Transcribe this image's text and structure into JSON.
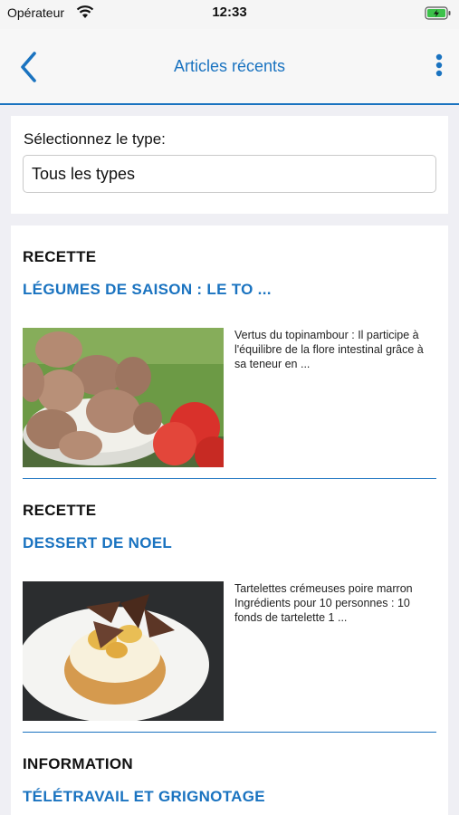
{
  "status_bar": {
    "carrier": "Opérateur",
    "time": "12:33",
    "icons": [
      "wifi-icon",
      "battery-charging-icon"
    ]
  },
  "nav": {
    "title": "Articles récents",
    "back_icon": "chevron-left-icon",
    "menu_icon": "more-vertical-icon"
  },
  "filter": {
    "label": "Sélectionnez le type:",
    "selected": "Tous les types"
  },
  "articles": [
    {
      "type": "RECETTE",
      "title": "LÉGUMES DE SAISON : LE TO ...",
      "excerpt": "Vertus du topinambour : Il participe à l'équilibre de la flore intestinal grâce à sa teneur en  ...",
      "image": "topinambour-photo"
    },
    {
      "type": "RECETTE",
      "title": "DESSERT DE NOEL",
      "excerpt": "Tartelettes crémeuses poire marron Ingrédients pour 10 personnes :        10 fonds de tartelette   1 ...",
      "image": "tartelette-photo"
    },
    {
      "type": "INFORMATION",
      "title": "TÉLÉTRAVAIL ET GRIGNOTAGE"
    }
  ],
  "colors": {
    "accent": "#1a73c0",
    "background": "#efeff4",
    "card": "#ffffff"
  }
}
